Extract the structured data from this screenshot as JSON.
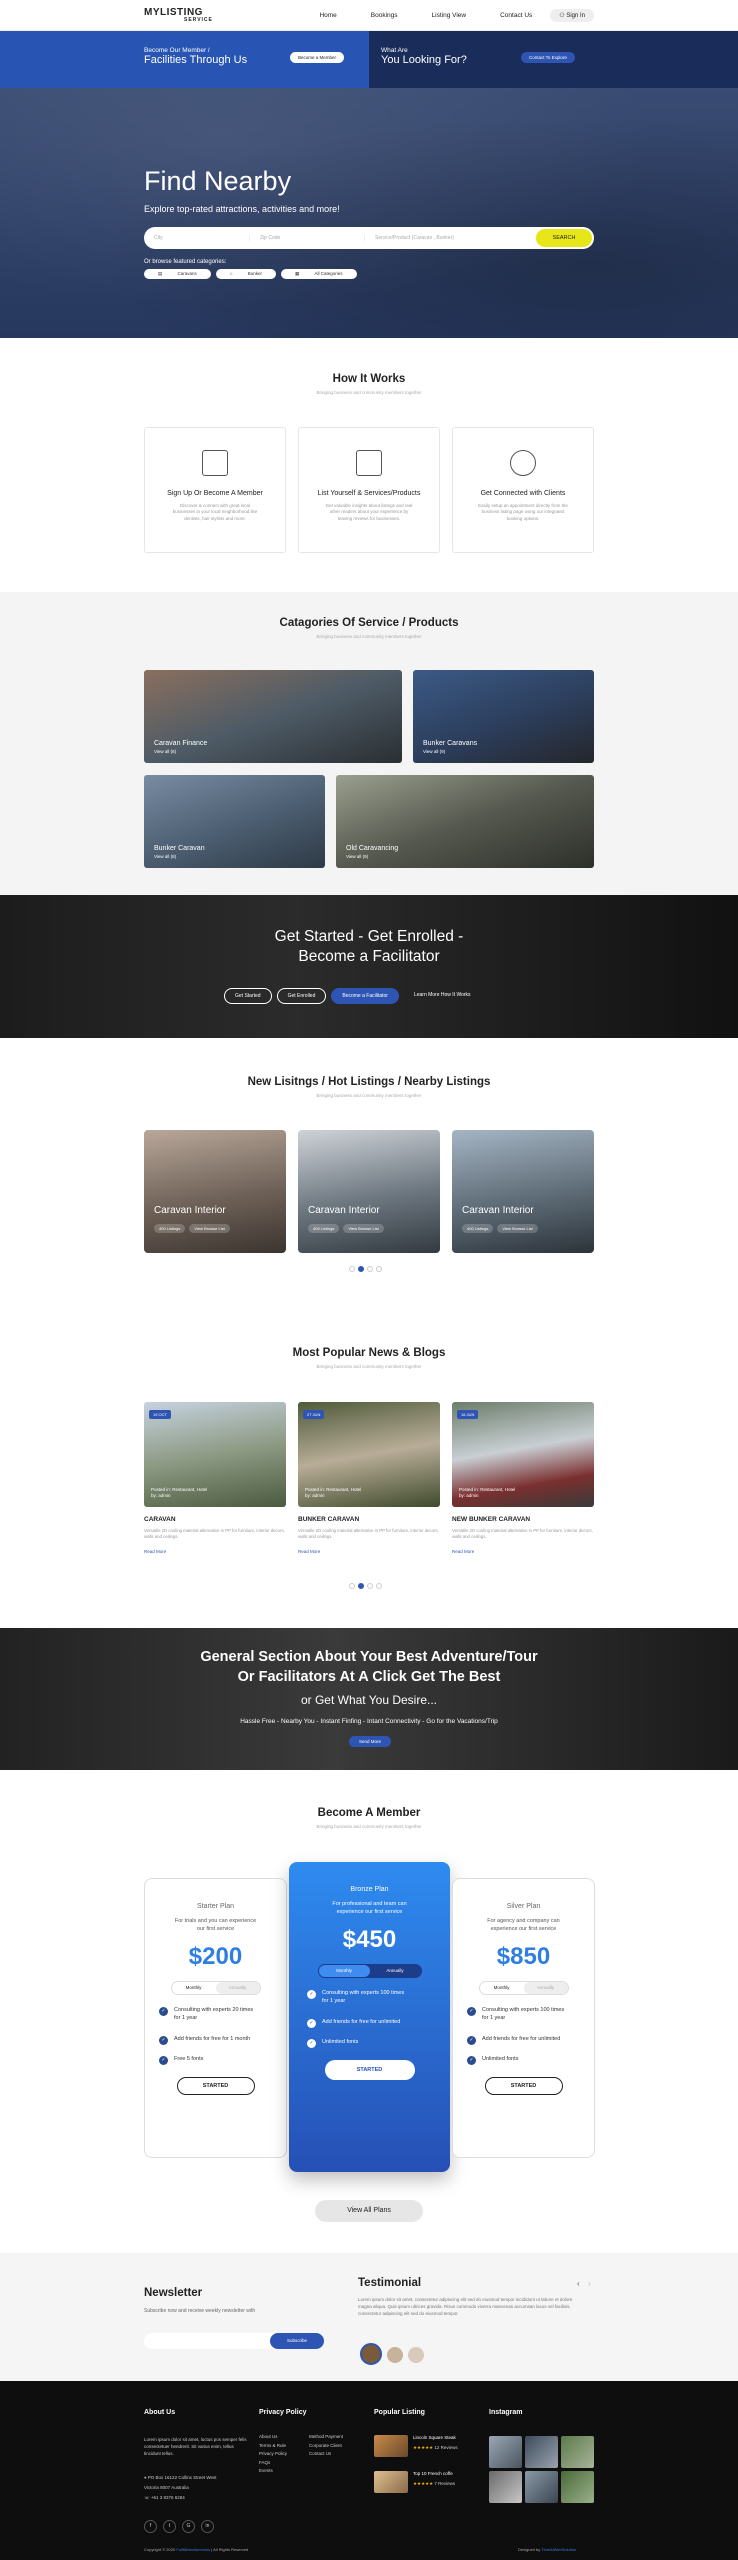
{
  "nav": {
    "logo": "MYLISTING",
    "logo_sub": "SERVICE",
    "items": [
      "Home",
      "Bookings",
      "Listing View",
      "Contact Us"
    ],
    "signin": "Sign In"
  },
  "cta": {
    "left_small": "Become Our Member /",
    "left_big": "Facilities Through Us",
    "left_btn": "Become a Member",
    "right_small": "What Are",
    "right_big": "You Looking For?",
    "right_btn": "Contact To Explore"
  },
  "hero": {
    "title": "Find Nearby",
    "subtitle": "Explore top-rated attractions, activities and more!",
    "city_placeholder": "City",
    "zip_placeholder": "Zip Code",
    "service_placeholder": "Service/Product (Caravan , Bunker)",
    "search_btn": "SEARCH",
    "browse_label": "Or browse featured categories:",
    "categories": [
      "Caravans",
      "Bunker",
      "All Categories"
    ]
  },
  "how": {
    "title": "How It Works",
    "tagline": "Bringing business and community members together",
    "steps": [
      {
        "title": "Sign Up Or Become A Member",
        "text": "Discover & connect with great local businesses in your local neighborhood like dentists, hair stylists and more."
      },
      {
        "title": "List Yourself & Services/Products",
        "text": "Get valuable insights about listings and real other readers about your experience by leaving reviews for businesses."
      },
      {
        "title": "Get Connected with Clients",
        "text": "Easily setup an appointment directly from the business listing page using our integrated booking options."
      }
    ]
  },
  "categories": {
    "title": "Catagories Of Service / Products",
    "tagline": "Bringing business and community members together",
    "tiles": [
      {
        "title": "Caravan Finance",
        "sub": "View all (6)"
      },
      {
        "title": "Bunker Caravans",
        "sub": "View all (9)"
      },
      {
        "title": "Bunker Caravan",
        "sub": "View all (8)"
      },
      {
        "title": "Old Caravancing",
        "sub": "View all (9)"
      }
    ]
  },
  "enroll": {
    "line1": "Get Started - Get Enrolled -",
    "line2": "Become a Facilitator",
    "buttons": [
      "Get Started",
      "Get Enrolled",
      "Become a Facilitator",
      "Learn More How It Works"
    ]
  },
  "listings": {
    "title": "New Lisitngs / Hot Listings / Nearby Listings",
    "tagline": "Bringing business and community members together",
    "cards": [
      {
        "title": "Caravan Interior",
        "l1": "400 Listings",
        "l2": "View Browse List"
      },
      {
        "title": "Caravan Interior",
        "l1": "400 Listings",
        "l2": "View Browse List"
      },
      {
        "title": "Caravan Interior",
        "l1": "400 Listings",
        "l2": "View Browse List"
      }
    ]
  },
  "blogs": {
    "title": "Most Popular News & Blogs",
    "tagline": "Bringing business and community members together",
    "posts": [
      {
        "date": "19 OCT",
        "cap1": "Posted in: Restaurant, Hotel",
        "cap2": "by: admin",
        "title": "CARAVAN",
        "text": "Versatile 2D cooling material alternative in PP for furniture, interior decors, walls and ceilings.",
        "more": "Read More"
      },
      {
        "date": "27 JUN",
        "cap1": "Posted in: Restaurant, Hotel",
        "cap2": "by: admin",
        "title": "BUNKER CARAVAN",
        "text": "Versatile 2D cooling material alternative in PP for furniture, interior decors, walls and ceilings.",
        "more": "Read More"
      },
      {
        "date": "16 JUN",
        "cap1": "Posted in: Restaurant, Hotel",
        "cap2": "by: admin",
        "title": "NEW BUNKER CARAVAN",
        "text": "Versatile 2D cooling material alternative in PP for furniture, interior decors, walls and ceilings.",
        "more": "Read More"
      }
    ]
  },
  "adv": {
    "line1": "General Section About Your Best Adventure/Tour",
    "line2": "Or Facilitators At A Click Get The Best",
    "line3": "or Get What You Desire...",
    "line4": "Hassle Free - Nearby You - Instant Finfing - Intant Connectivity - Go for the Vacations/Trip",
    "btn": "Send More"
  },
  "member": {
    "title": "Become A Member",
    "tagline": "Bringing business and community members together",
    "plans": [
      {
        "name": "Starter Plan",
        "desc": "For trials and you can experience our first service",
        "price": "$200",
        "monthly": "Monthly",
        "annually": "Annually",
        "features": [
          "Consulting with experts 20 times for 1 year",
          "Add friends for free for 1 month",
          "Free 5 fonts"
        ],
        "btn": "STARTED"
      },
      {
        "name": "Bronze Plan",
        "desc": "For professional and team can experience our first service",
        "price": "$450",
        "monthly": "Monthly",
        "annually": "Annually",
        "features": [
          "Consulting with experts 100 times for 1 year",
          "Add friends for free for unlimited",
          "Unlimited fonts"
        ],
        "btn": "STARTED"
      },
      {
        "name": "Silver Plan",
        "desc": "For agency and company can experience our first service",
        "price": "$850",
        "monthly": "Monthly",
        "annually": "Annually",
        "features": [
          "Consulting with experts 100 times for 1 year",
          "Add friends for free for unlimited",
          "Unlimited fonts"
        ],
        "btn": "STARTED"
      }
    ],
    "view_all": "View All Plans"
  },
  "newsletter": {
    "title": "Newsletter",
    "sub": "Subscribe now and receive weekly newsletter with",
    "btn": "Subscribe"
  },
  "testimonial": {
    "title": "Testimonial",
    "text": "Lorem ipsum dolor sit amet, consectetur adipiscing elit sed do eiusmod tempor incididunt ut labore et dolore magna aliqua. Quis ipsum ultrices gravida. Risus commodo viverra maecenas accumsan lacus vel facilisis. consectetur adipiscing elit sed do eiusmod tempor."
  },
  "footer": {
    "about_title": "About Us",
    "about_text": "Lorem ipsum dolor sit amet, luctus pos semper felis consectetuer hendrerit. Sit varius enim, tellus tincidunt tellus.",
    "address": "PO Box 16122 Collins Street West",
    "state": "Victoria 8007 Australia",
    "phone": "+61 3 8376 6284",
    "privacy_title": "Privacy Policy",
    "col2": [
      "About Us",
      "Terms & Rule",
      "Privacy Policy",
      "FAQs",
      "Events"
    ],
    "col3": [
      "Method Payment",
      "Corporate Client",
      "Contact Us"
    ],
    "popular_title": "Popular Listing",
    "pop": [
      {
        "name": "Lincoln Square Steak",
        "rev": "12 Reviews"
      },
      {
        "name": "Top 10 French coffe",
        "rev": "7 Reviews"
      }
    ],
    "insta_title": "Instagram",
    "copyright": "Copyright © 2020 ",
    "copy_brand": "Fullfillmentservices",
    "copy_rest": " | All Rights Reserved",
    "designed": "Designed by ",
    "designer": "TimeAiWebSolution"
  },
  "colors": {
    "primary": "#2e55b3",
    "accent": "#e6e619",
    "price": "#2e7fe0",
    "dark": "#0e0e0e"
  }
}
